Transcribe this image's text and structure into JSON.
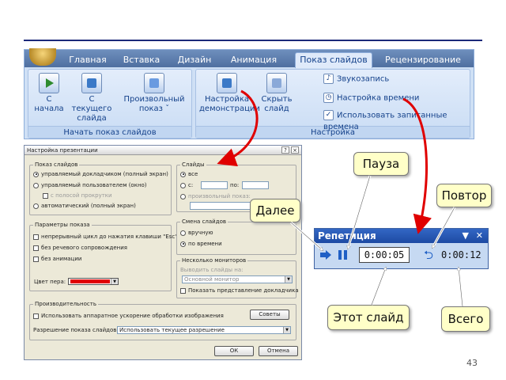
{
  "ribbon": {
    "tabs": [
      "Главная",
      "Вставка",
      "Дизайн",
      "Анимация",
      "Показ слайдов",
      "Рецензирование"
    ],
    "active_tab": "Показ слайдов",
    "groups": {
      "start": {
        "label": "Начать показ слайдов",
        "buttons": [
          "С начала",
          "С текущего слайда",
          "Произвольный показ ˇ"
        ]
      },
      "setup": {
        "label": "Настройка",
        "buttons": [
          "Настройка демонстрации",
          "Скрыть слайд"
        ],
        "rows": [
          "Звукозапись",
          "Настройка времени",
          "Использовать записанные времена"
        ],
        "use_timings_checked": "✓"
      }
    }
  },
  "dialog": {
    "title": "Настройка презентации",
    "help": "?",
    "close": "×",
    "show_type": {
      "legend": "Показ слайдов",
      "opt1": "управляемый докладчиком (полный экран)",
      "opt2": "управляемый пользователем (окно)",
      "opt2_sub": "с полосой прокрутки",
      "opt3": "автоматический (полный экран)"
    },
    "show_options": {
      "legend": "Параметры показа",
      "loop": "непрерывный цикл до нажатия клавиши \"Esc\"",
      "no_narration": "без речевого сопровождения",
      "no_animation": "без анимации",
      "pen_color_label": "Цвет пера:"
    },
    "slides": {
      "legend": "Слайды",
      "all": "все",
      "from": "с:",
      "to": "по:",
      "custom": "произвольный показ:"
    },
    "advance": {
      "legend": "Смена слайдов",
      "manual": "вручную",
      "timings": "по времени"
    },
    "monitors": {
      "legend": "Несколько мониторов",
      "show_on": "Выводить слайды на:",
      "monitor_value": "Основной монитор",
      "presenter_view": "Показать представление докладчика"
    },
    "performance": {
      "legend": "Производительность",
      "hw_accel": "Использовать аппаратное ускорение обработки изображения",
      "tips_btn": "Советы",
      "resolution_label": "Разрешение показа слайдов:",
      "resolution_value": "Использовать текущее разрешение"
    },
    "ok": "ОК",
    "cancel": "Отмена"
  },
  "rehearsal": {
    "title": "Репетиция",
    "menu_glyph": "▼",
    "close_glyph": "✕",
    "slide_time": "0:00:05",
    "total_time": "0:00:12",
    "repeat_glyph": "⮌"
  },
  "callouts": {
    "pause": "Пауза",
    "repeat": "Повтор",
    "next": "Далее",
    "this_slide": "Этот слайд",
    "total": "Всего"
  },
  "slide_number": "43",
  "colors": {
    "pen": "#e00000",
    "callout_bg": "#ffffc8",
    "arrow": "#e00000"
  }
}
